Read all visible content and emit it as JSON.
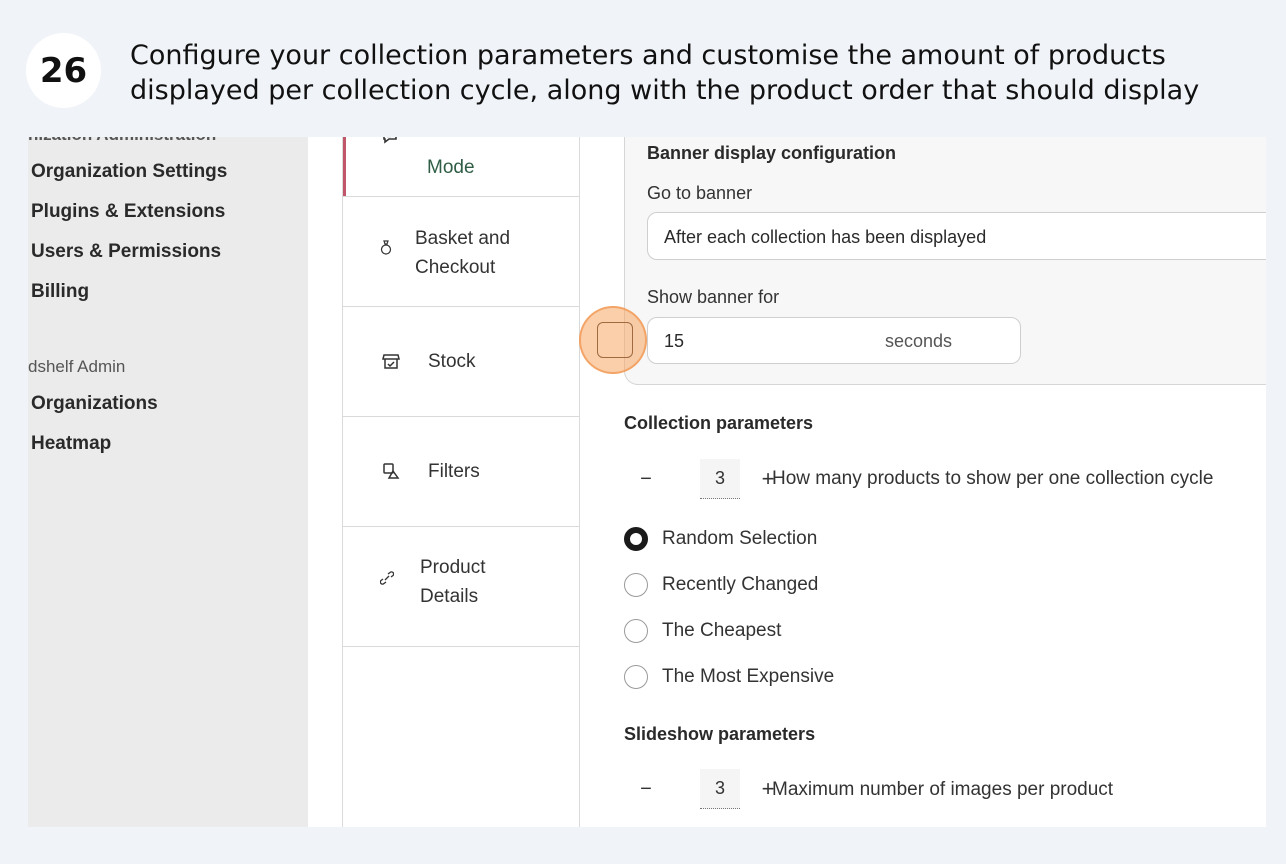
{
  "step": {
    "number": "26",
    "instruction": "Configure your collection parameters and customise the amount of products displayed per collection cycle, along with the product order that should display"
  },
  "sidebar": {
    "cut_section": "nization Administration",
    "items": [
      {
        "label": "Organization Settings"
      },
      {
        "label": "Plugins & Extensions"
      },
      {
        "label": "Users & Permissions"
      },
      {
        "label": "Billing"
      }
    ],
    "section2": "dshelf Admin",
    "items2": [
      {
        "label": "Organizations"
      },
      {
        "label": "Heatmap"
      }
    ]
  },
  "tabs": [
    {
      "label": "Mode",
      "icon": "speech-bubble-icon",
      "active": true
    },
    {
      "label": "Basket and Checkout",
      "icon": "money-bag-icon"
    },
    {
      "label": "Stock",
      "icon": "store-icon"
    },
    {
      "label": "Filters",
      "icon": "image-filter-icon"
    },
    {
      "label": "Product Details",
      "icon": "link-icon"
    }
  ],
  "banner": {
    "title": "Banner display configuration",
    "go_to_label": "Go to banner",
    "go_to_value": "After each collection has been displayed",
    "show_for_label": "Show banner for",
    "show_for_value": "15",
    "show_for_unit": "seconds"
  },
  "collection": {
    "title": "Collection parameters",
    "minus": "−",
    "count": "3",
    "plus": "+",
    "description": "How many products to show per one collection cycle",
    "options": [
      {
        "label": "Random Selection",
        "checked": true
      },
      {
        "label": "Recently Changed",
        "checked": false
      },
      {
        "label": "The Cheapest",
        "checked": false
      },
      {
        "label": "The Most Expensive",
        "checked": false
      }
    ]
  },
  "slideshow": {
    "title": "Slideshow parameters",
    "minus": "−",
    "count": "3",
    "plus": "+",
    "description": "Maximum number of images per product"
  },
  "colors": {
    "accent_active_tab": "#c0566a",
    "active_tab_text": "#2f5d45",
    "highlight": "#f6a864"
  }
}
